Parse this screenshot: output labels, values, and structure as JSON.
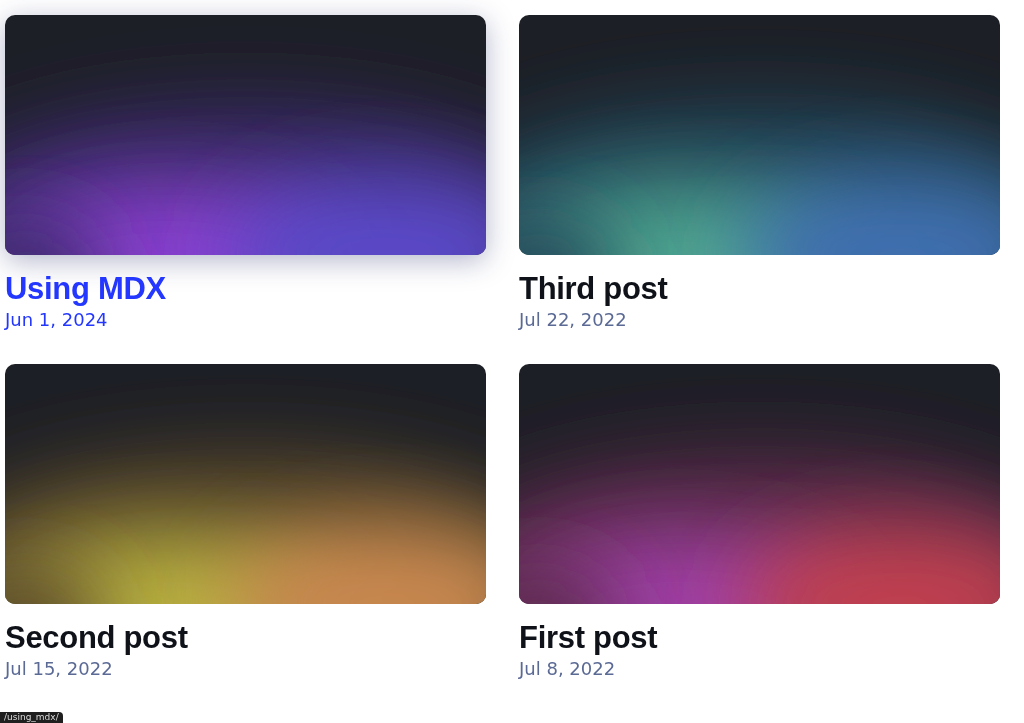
{
  "posts": [
    {
      "title": "Using MDX",
      "date": "Jun 1, 2024",
      "hovered": true
    },
    {
      "title": "Third post",
      "date": "Jul 22, 2022",
      "hovered": false
    },
    {
      "title": "Second post",
      "date": "Jul 15, 2022",
      "hovered": false
    },
    {
      "title": "First post",
      "date": "Jul 8, 2022",
      "hovered": false
    }
  ],
  "status_bar": {
    "url": "/using_mdx/"
  }
}
